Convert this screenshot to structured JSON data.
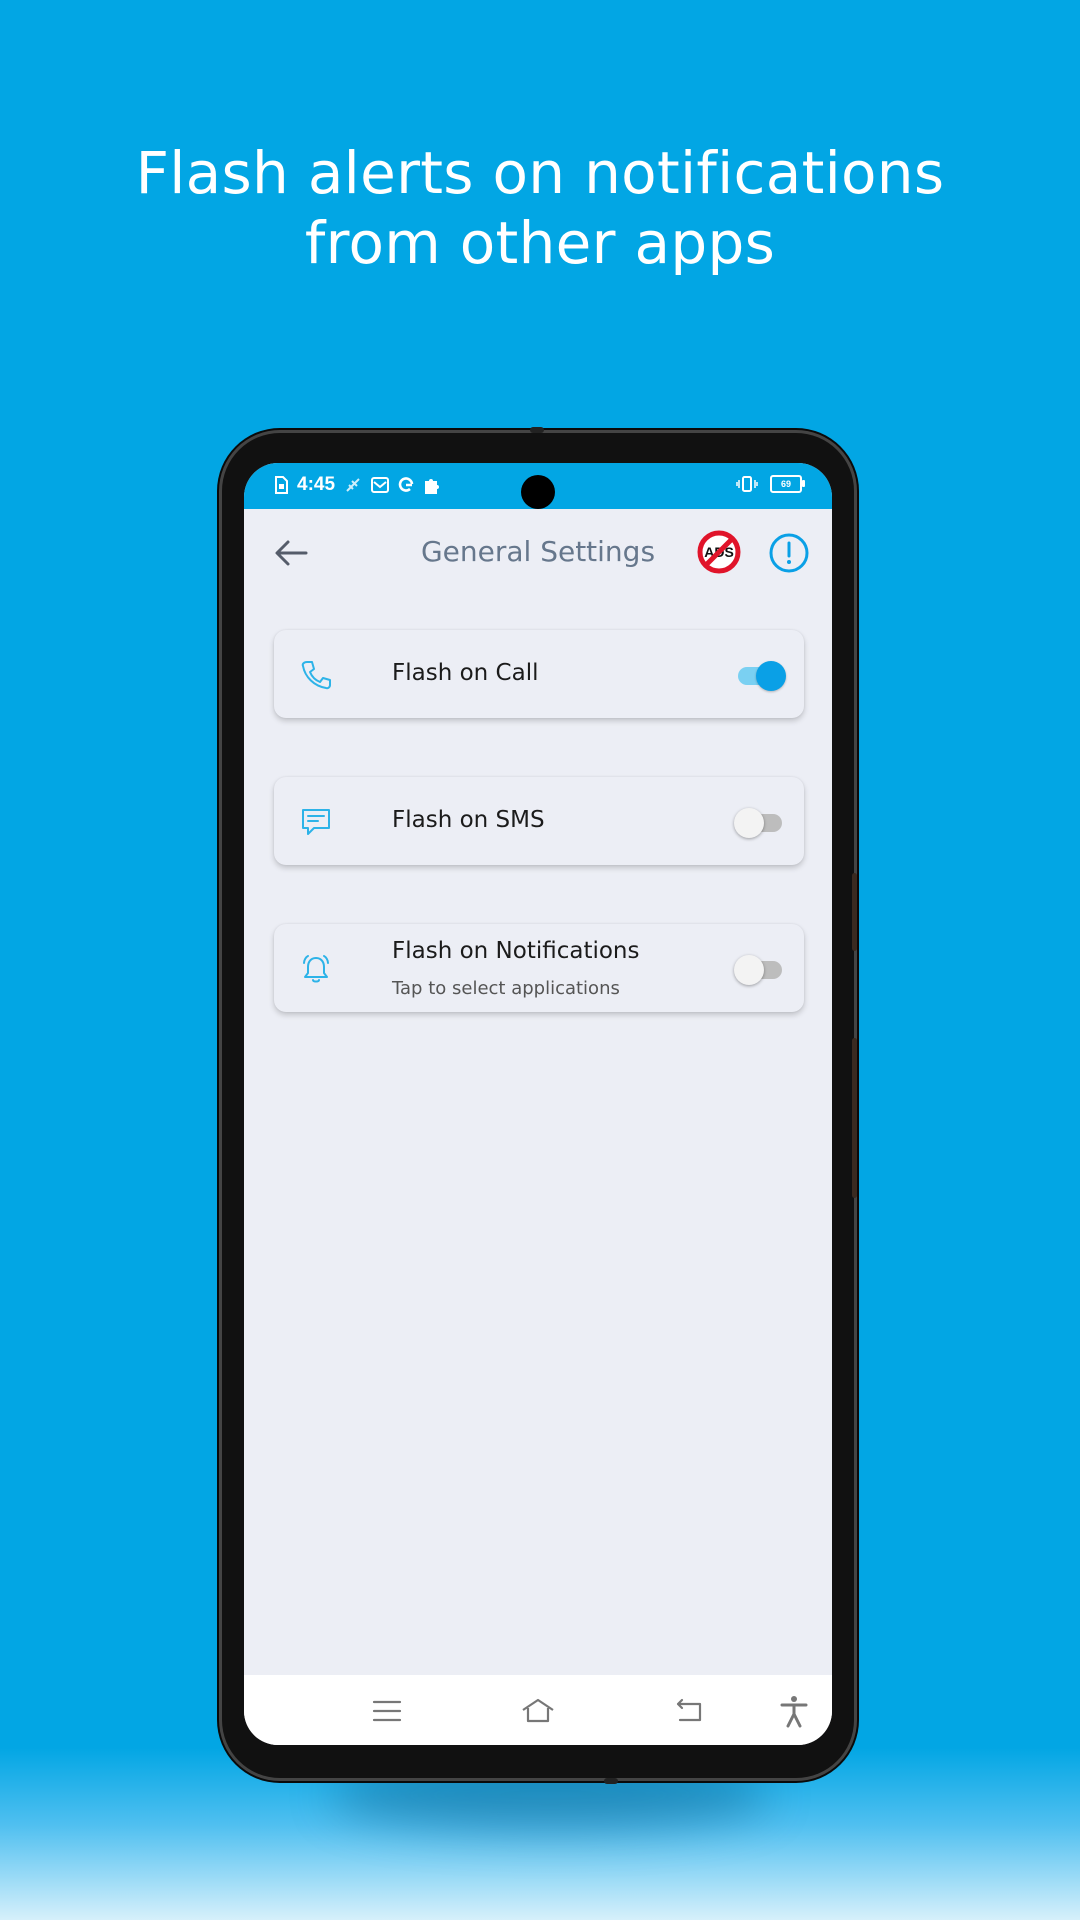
{
  "promo": {
    "title_line1": "Flash alerts on notifications",
    "title_line2": "from other apps"
  },
  "status_bar": {
    "time": "4:45",
    "battery_level": "69",
    "icons_left": [
      "sim-icon",
      "signal-off-icon",
      "mail-icon",
      "google-icon",
      "puzzle-icon"
    ],
    "icons_right": [
      "vibrate-icon",
      "battery-icon"
    ]
  },
  "app_bar": {
    "title": "General Settings",
    "back_icon": "arrow-left-icon",
    "no_ads_text": "ADS",
    "info_icon": "info-circle-icon"
  },
  "settings": [
    {
      "label": "Flash on Call",
      "subtitle": "",
      "icon": "phone-icon",
      "enabled": true
    },
    {
      "label": "Flash on SMS",
      "subtitle": "",
      "icon": "message-icon",
      "enabled": false
    },
    {
      "label": "Flash on Notifications",
      "subtitle": "Tap to select applications",
      "icon": "bell-icon",
      "enabled": false
    }
  ],
  "nav_bar": {
    "items": [
      "menu-icon",
      "home-icon",
      "back-nav-icon",
      "accessibility-icon"
    ]
  },
  "colors": {
    "background": "#02a6e4",
    "accent": "#0aa0e6",
    "toggle_track_on": "#7ad0f2",
    "toggle_off": "#bdbdbd",
    "screen_bg": "#eceef5",
    "title_gray": "#66778c",
    "no_ads_red": "#e0142a"
  }
}
